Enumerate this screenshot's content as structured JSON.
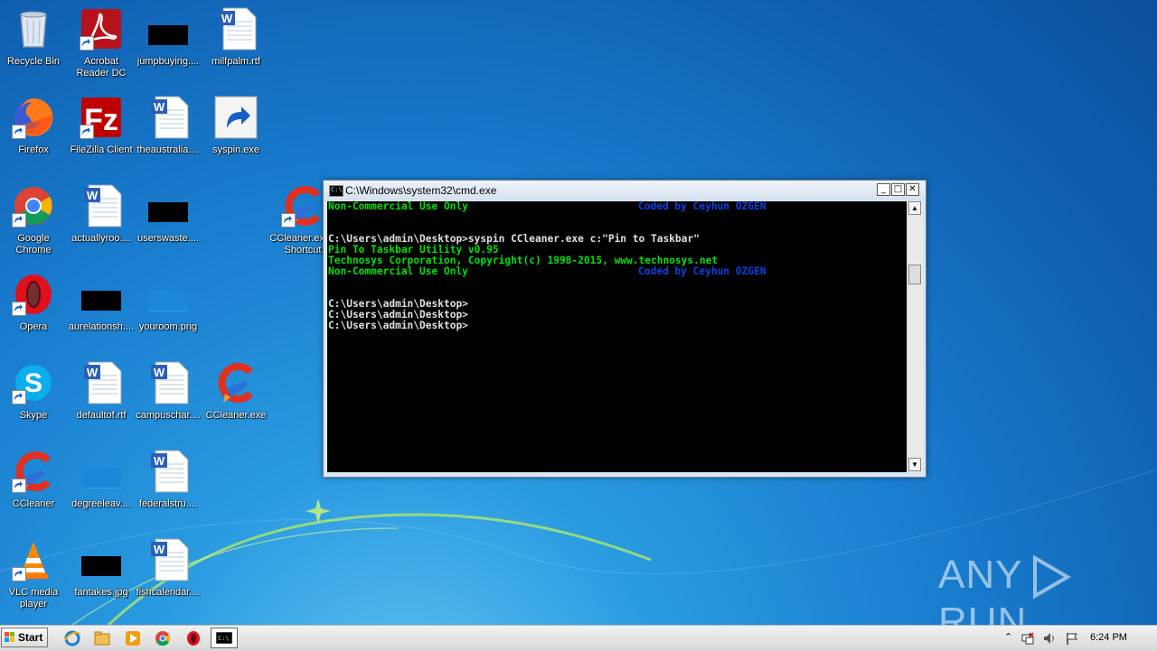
{
  "desktop": {
    "icons": [
      {
        "label": "Recycle Bin",
        "icon": "recycle-bin-icon"
      },
      {
        "label": "Acrobat Reader DC",
        "icon": "acrobat-icon"
      },
      {
        "label": "jumpbuying....",
        "icon": "image-file-icon"
      },
      {
        "label": "milfpalm.rtf",
        "icon": "word-doc-icon"
      },
      {
        "label": "Firefox",
        "icon": "firefox-icon"
      },
      {
        "label": "FileZilla Client",
        "icon": "filezilla-icon"
      },
      {
        "label": "theaustralia....",
        "icon": "word-doc-icon"
      },
      {
        "label": "syspin.exe",
        "icon": "exe-icon"
      },
      {
        "label": "Google Chrome",
        "icon": "chrome-icon"
      },
      {
        "label": "actuallyroo....",
        "icon": "word-doc-icon"
      },
      {
        "label": "userswaste....",
        "icon": "image-file-icon"
      },
      {
        "label": "CCleaner.exe - Shortcut",
        "icon": "ccleaner-icon"
      },
      {
        "label": "Opera",
        "icon": "opera-icon"
      },
      {
        "label": "aurelationsh....",
        "icon": "image-file-icon"
      },
      {
        "label": "youroom.png",
        "icon": "image-file-icon"
      },
      {
        "label": "Skype",
        "icon": "skype-icon"
      },
      {
        "label": "defaultof.rtf",
        "icon": "word-doc-icon"
      },
      {
        "label": "campuschar....",
        "icon": "word-doc-icon"
      },
      {
        "label": "CCleaner.exe",
        "icon": "ccleaner-icon"
      },
      {
        "label": "CCleaner",
        "icon": "ccleaner-icon"
      },
      {
        "label": "degreeleav....",
        "icon": "image-file-icon"
      },
      {
        "label": "federalstru....",
        "icon": "word-doc-icon"
      },
      {
        "label": "VLC media player",
        "icon": "vlc-icon"
      },
      {
        "label": "fantakes.jpg",
        "icon": "image-file-icon"
      },
      {
        "label": "fishcalendar....",
        "icon": "word-doc-icon"
      }
    ]
  },
  "cmd": {
    "title": "C:\\Windows\\system32\\cmd.exe",
    "lines": [
      {
        "text": "Non-Commercial Use Only",
        "right": "Coded by Ceyhun OZGEN"
      },
      {
        "text": ""
      },
      {
        "text": "C:\\Users\\admin\\Desktop>syspin CCleaner.exe c:\"Pin to Taskbar\""
      },
      {
        "text": "Pin To Taskbar Utility v0.95"
      },
      {
        "text": "Technosys Corporation, Copyright(c) 1998-2015, www.technosys.net"
      },
      {
        "text": "Non-Commercial Use Only",
        "right": "Coded by Ceyhun OZGEN"
      },
      {
        "text": ""
      },
      {
        "text": "C:\\Users\\admin\\Desktop>"
      },
      {
        "text": "C:\\Users\\admin\\Desktop>"
      },
      {
        "text": "C:\\Users\\admin\\Desktop>"
      }
    ],
    "minimize": "_",
    "maximize": "□",
    "close": "✕"
  },
  "taskbar": {
    "start_label": "Start",
    "clock": "6:24 PM",
    "tray_up": "⌃"
  },
  "watermark": {
    "text_a": "ANY",
    "text_b": "RUN"
  },
  "colors": {
    "accent": "#1a7fd0",
    "console_green": "#00e000",
    "console_blue": "#1040e0"
  }
}
